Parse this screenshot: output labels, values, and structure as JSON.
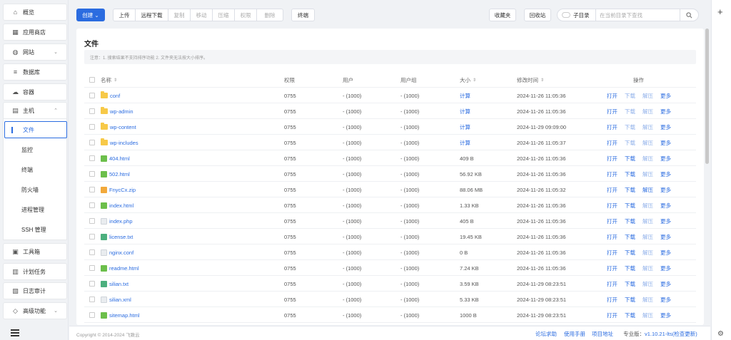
{
  "sidebar": {
    "items": [
      {
        "label": "概览",
        "icon": "home-icon",
        "glyph": "⌂"
      },
      {
        "label": "应用商店",
        "icon": "grid-icon",
        "glyph": "▦"
      },
      {
        "label": "网站",
        "icon": "globe-icon",
        "glyph": "◍"
      },
      {
        "label": "数据库",
        "icon": "database-icon",
        "glyph": "≡"
      },
      {
        "label": "容器",
        "icon": "container-icon",
        "glyph": "☁"
      },
      {
        "label": "主机",
        "icon": "host-icon",
        "glyph": "▤"
      }
    ],
    "host_sub": [
      {
        "label": "文件",
        "active": true
      },
      {
        "label": "监控"
      },
      {
        "label": "终端"
      },
      {
        "label": "防火墙"
      },
      {
        "label": "进程管理"
      },
      {
        "label": "SSH 管理"
      }
    ],
    "items_bottom": [
      {
        "label": "工具箱",
        "icon": "toolbox-icon",
        "glyph": "▣"
      },
      {
        "label": "计划任务",
        "icon": "calendar-icon",
        "glyph": "▥"
      },
      {
        "label": "日志审计",
        "icon": "log-icon",
        "glyph": "▧"
      },
      {
        "label": "高级功能",
        "icon": "diamond-icon",
        "glyph": "◇"
      }
    ]
  },
  "toolbar": {
    "create": "创建",
    "upload": "上传",
    "remote_download": "远程下载",
    "copy": "复制",
    "move": "移动",
    "compress": "压缩",
    "permission": "权限",
    "delete": "删除",
    "terminal": "终端",
    "favorites": "收藏夹",
    "recycle": "回收站",
    "subdir": "子目录",
    "search_placeholder": "在当前目录下查找"
  },
  "files": {
    "title": "文件",
    "notice": "注意：1. 搜索结果不支持排序功能 2. 文件夹无法按大小排序。",
    "headers": {
      "name": "名称",
      "perm": "权限",
      "user": "用户",
      "group": "用户组",
      "size": "大小",
      "time": "修改时间",
      "ops": "操作"
    },
    "ops_labels": {
      "open": "打开",
      "download": "下载",
      "extract": "解压",
      "more": "更多"
    },
    "rows": [
      {
        "name": "conf",
        "type": "folder",
        "perm": "0755",
        "user": "- (1000)",
        "group": "- (1000)",
        "size": "计算",
        "time": "2024-11-26 11:05:36"
      },
      {
        "name": "wp-admin",
        "type": "folder",
        "perm": "0755",
        "user": "- (1000)",
        "group": "- (1000)",
        "size": "计算",
        "time": "2024-11-26 11:05:36"
      },
      {
        "name": "wp-content",
        "type": "folder",
        "perm": "0755",
        "user": "- (1000)",
        "group": "- (1000)",
        "size": "计算",
        "time": "2024-11-29 09:09:00"
      },
      {
        "name": "wp-includes",
        "type": "folder",
        "perm": "0755",
        "user": "- (1000)",
        "group": "- (1000)",
        "size": "计算",
        "time": "2024-11-26 11:05:37"
      },
      {
        "name": "404.html",
        "type": "html",
        "perm": "0755",
        "user": "- (1000)",
        "group": "- (1000)",
        "size": "409 B",
        "time": "2024-11-26 11:05:36"
      },
      {
        "name": "502.html",
        "type": "html",
        "perm": "0755",
        "user": "- (1000)",
        "group": "- (1000)",
        "size": "56.92 KB",
        "time": "2024-11-26 11:05:36"
      },
      {
        "name": "FnycCx.zip",
        "type": "zip",
        "perm": "0755",
        "user": "- (1000)",
        "group": "- (1000)",
        "size": "88.06 MB",
        "time": "2024-11-26 11:05:32"
      },
      {
        "name": "index.html",
        "type": "html",
        "perm": "0755",
        "user": "- (1000)",
        "group": "- (1000)",
        "size": "1.33 KB",
        "time": "2024-11-26 11:05:36"
      },
      {
        "name": "index.php",
        "type": "plain",
        "perm": "0755",
        "user": "- (1000)",
        "group": "- (1000)",
        "size": "405 B",
        "time": "2024-11-26 11:05:36"
      },
      {
        "name": "license.txt",
        "type": "txt",
        "perm": "0755",
        "user": "- (1000)",
        "group": "- (1000)",
        "size": "19.45 KB",
        "time": "2024-11-26 11:05:36"
      },
      {
        "name": "nginx.conf",
        "type": "plain",
        "perm": "0755",
        "user": "- (1000)",
        "group": "- (1000)",
        "size": "0 B",
        "time": "2024-11-26 11:05:36"
      },
      {
        "name": "readme.html",
        "type": "html",
        "perm": "0755",
        "user": "- (1000)",
        "group": "- (1000)",
        "size": "7.24 KB",
        "time": "2024-11-26 11:05:36"
      },
      {
        "name": "silian.txt",
        "type": "txt",
        "perm": "0755",
        "user": "- (1000)",
        "group": "- (1000)",
        "size": "3.59 KB",
        "time": "2024-11-29 08:23:51"
      },
      {
        "name": "silian.xml",
        "type": "plain",
        "perm": "0755",
        "user": "- (1000)",
        "group": "- (1000)",
        "size": "5.33 KB",
        "time": "2024-11-29 08:23:51"
      },
      {
        "name": "sitemap.html",
        "type": "html",
        "perm": "0755",
        "user": "- (1000)",
        "group": "- (1000)",
        "size": "1000 B",
        "time": "2024-11-29 08:23:51"
      }
    ]
  },
  "footer": {
    "copyright": "Copyright © 2014-2024 飞致云",
    "forum": "论坛求助",
    "manual": "使用手册",
    "project": "项目地址",
    "edition": "专业版：",
    "version": "v1.10.21-lts",
    "check": "(检查更新)"
  },
  "colors": {
    "accent": "#2b6ce0"
  }
}
